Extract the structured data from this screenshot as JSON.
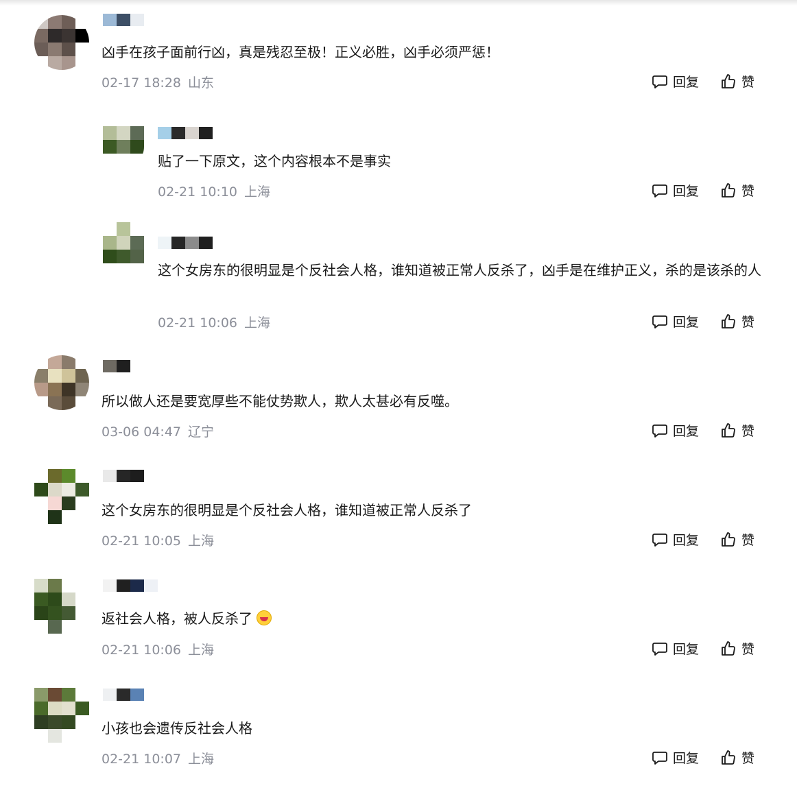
{
  "comments": [
    {
      "text": "凶手在孩子面前行凶，真是残忍至极！正义必胜，凶手必须严惩！",
      "date": "02-17 18:28",
      "location": "山东",
      "reply_label": "回复",
      "like_label": "赞"
    },
    {
      "text": "贴了一下原文，这个内容根本不是事实",
      "date": "02-21 10:10",
      "location": "上海",
      "reply_label": "回复",
      "like_label": "赞"
    },
    {
      "text": "这个女房东的很明显是个反社会人格，谁知道被正常人反杀了，凶手是在维护正义，杀的是该杀的人",
      "date": "02-21 10:06",
      "location": "上海",
      "reply_label": "回复",
      "like_label": "赞"
    },
    {
      "text": "所以做人还是要宽厚些不能仗势欺人，欺人太甚必有反噬。",
      "date": "03-06 04:47",
      "location": "辽宁",
      "reply_label": "回复",
      "like_label": "赞"
    },
    {
      "text": "这个女房东的很明显是个反社会人格，谁知道被正常人反杀了",
      "date": "02-21 10:05",
      "location": "上海",
      "reply_label": "回复",
      "like_label": "赞"
    },
    {
      "text": "返社会人格，被人反杀了",
      "emoji": "grinning-face-emoji",
      "date": "02-21 10:06",
      "location": "上海",
      "reply_label": "回复",
      "like_label": "赞"
    },
    {
      "text": "小孩也会遗传反社会人格",
      "date": "02-21 10:07",
      "location": "上海",
      "reply_label": "回复",
      "like_label": "赞"
    }
  ],
  "icons": {
    "reply": "comment-bubble-icon",
    "like": "thumbs-up-icon"
  },
  "colors": {
    "text": "#1a1a1a",
    "meta": "#8c8f99"
  }
}
